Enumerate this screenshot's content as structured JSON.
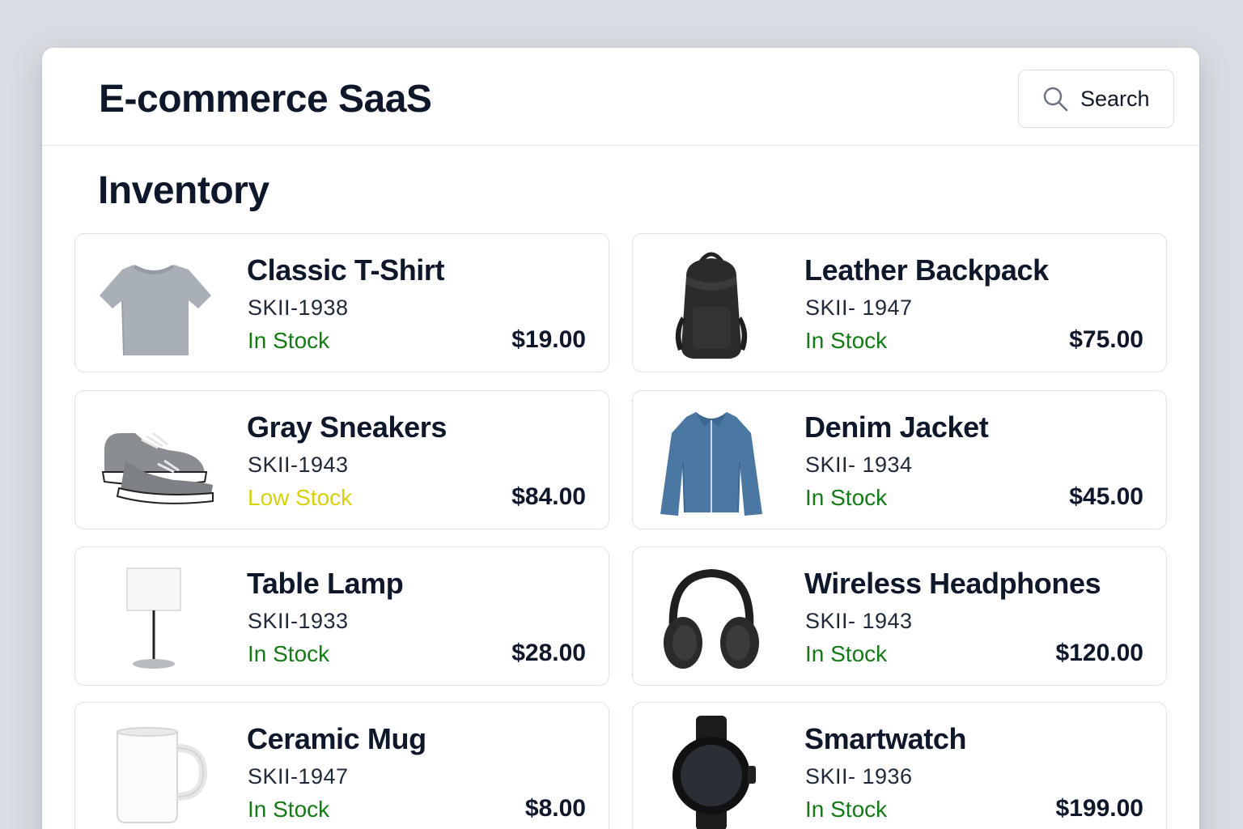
{
  "header": {
    "app_title": "E-commerce SaaS",
    "search_label": "Search"
  },
  "main": {
    "page_title": "Inventory"
  },
  "status_colors": {
    "In Stock": "#137b13",
    "Low Stock": "#d8d10a"
  },
  "products": [
    {
      "name": "Classic T-Shirt",
      "sku": "SKII-1938",
      "status": "In Stock",
      "price": "$19.00",
      "icon": "tshirt-icon"
    },
    {
      "name": "Leather Backpack",
      "sku": "SKII- 1947",
      "status": "In Stock",
      "price": "$75.00",
      "icon": "backpack-icon"
    },
    {
      "name": "Gray Sneakers",
      "sku": "SKII-1943",
      "status": "Low Stock",
      "price": "$84.00",
      "icon": "sneakers-icon"
    },
    {
      "name": "Denim Jacket",
      "sku": "SKII- 1934",
      "status": "In Stock",
      "price": "$45.00",
      "icon": "jacket-icon"
    },
    {
      "name": "Table Lamp",
      "sku": "SKII-1933",
      "status": "In Stock",
      "price": "$28.00",
      "icon": "lamp-icon"
    },
    {
      "name": "Wireless Headphones",
      "sku": "SKII- 1943",
      "status": "In Stock",
      "price": "$120.00",
      "icon": "headphones-icon"
    },
    {
      "name": "Ceramic Mug",
      "sku": "SKII-1947",
      "status": "In Stock",
      "price": "$8.00",
      "icon": "mug-icon"
    },
    {
      "name": "Smartwatch",
      "sku": "SKII- 1936",
      "status": "In Stock",
      "price": "$199.00",
      "icon": "smartwatch-icon"
    }
  ]
}
